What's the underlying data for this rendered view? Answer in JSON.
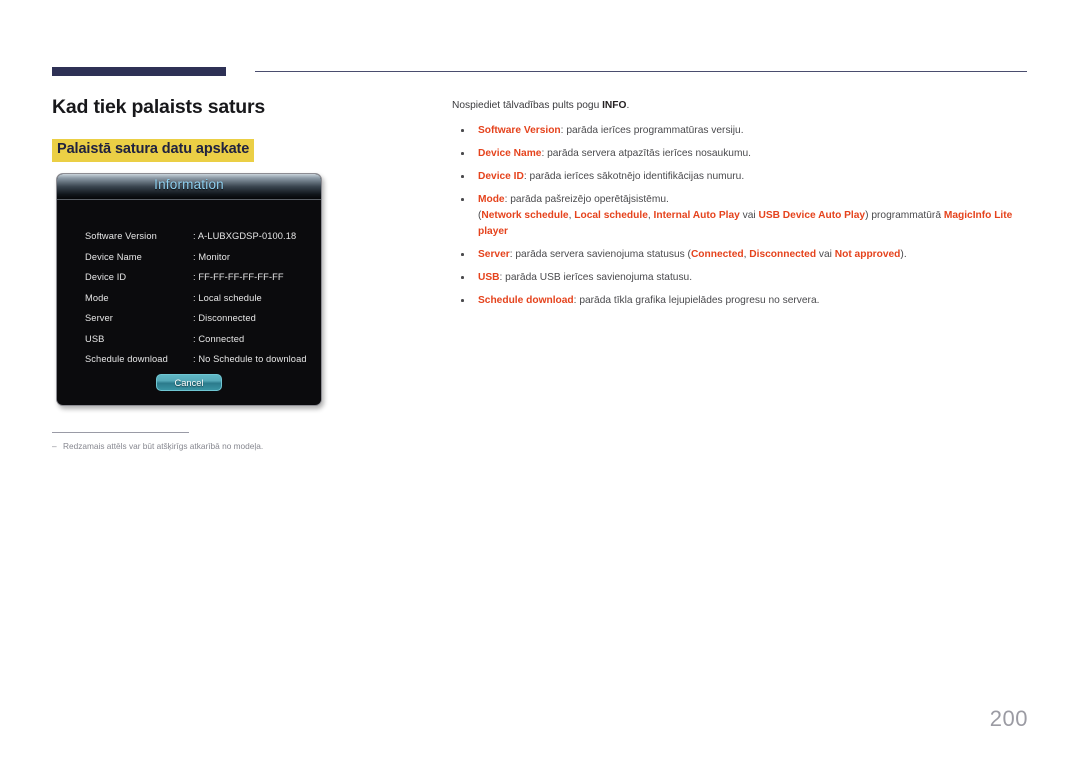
{
  "page": {
    "number": "200"
  },
  "left": {
    "title": "Kad tiek palaists saturs",
    "subtitle": "Palaistā satura datu apskate",
    "footnote_dash": "–",
    "footnote": "Redzamais attēls var būt atšķirīgs atkarībā no modeļa."
  },
  "dialog": {
    "title": "Information",
    "rows": [
      {
        "label": "Software Version",
        "value": ": A-LUBXGDSP-0100.18"
      },
      {
        "label": "Device Name",
        "value": ": Monitor"
      },
      {
        "label": "Device ID",
        "value": ": FF-FF-FF-FF-FF-FF"
      },
      {
        "label": "Mode",
        "value": ": Local schedule"
      },
      {
        "label": "Server",
        "value": ": Disconnected"
      },
      {
        "label": "USB",
        "value": ": Connected"
      },
      {
        "label": "Schedule download",
        "value": ": No Schedule to download"
      }
    ],
    "cancel_label": "Cancel"
  },
  "right": {
    "intro_before": "Nospiediet tālvadības pults pogu ",
    "intro_key": "INFO",
    "intro_after": ".",
    "bullets": [
      {
        "key": "Software Version",
        "text": ": parāda ierīces programmatūras versiju."
      },
      {
        "key": "Device Name",
        "text": ": parāda servera atpazītās ierīces nosaukumu."
      },
      {
        "key": "Device ID",
        "text": ": parāda ierīces sākotnējo identifikācijas numuru."
      },
      {
        "key": "Mode",
        "text": ": parāda pašreizējo operētājsistēmu.",
        "sub": {
          "paren_open": "(",
          "opt1": "Network schedule",
          "sep1": ", ",
          "opt2": "Local schedule",
          "sep2": ", ",
          "opt3": "Internal Auto Play",
          "sep3": " vai ",
          "opt4": "USB Device Auto Play",
          "paren_close": ") ",
          "mid": "programmatūrā ",
          "product": "MagicInfo Lite player"
        }
      },
      {
        "key": "Server",
        "text_a": ": parāda servera savienojuma statusus (",
        "opt1": "Connected",
        "sep1": ", ",
        "opt2": "Disconnected",
        "sep2": " vai ",
        "opt3": "Not approved",
        "text_b": ")."
      },
      {
        "key": "USB",
        "text": ": parāda USB ierīces savienojuma statusu."
      },
      {
        "key": "Schedule download",
        "text": ": parāda tīkla grafika lejupielādes progresu no servera."
      }
    ]
  },
  "colors": {
    "accent_orange": "#e5431d",
    "highlight_yellow": "#ebcf45",
    "header_navy": "#2e3155",
    "osd_title_blue": "#8fd0f0",
    "osd_button_teal": "#56a9b8"
  }
}
